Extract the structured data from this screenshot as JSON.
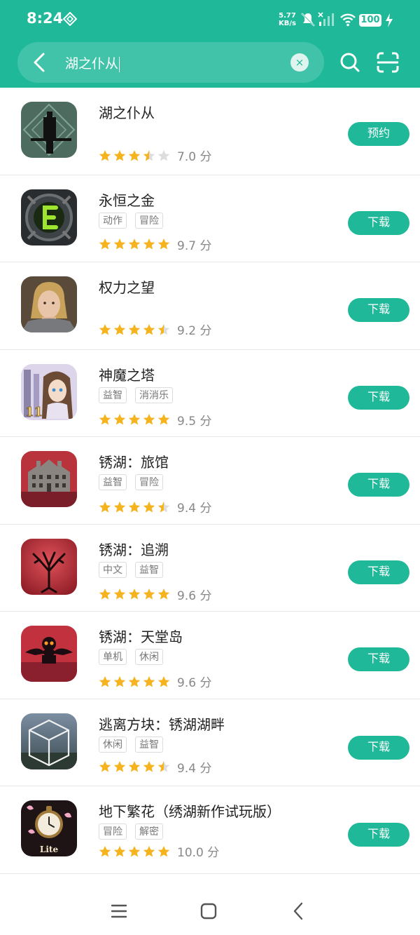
{
  "status_bar": {
    "time": "8:24",
    "speed_value": "5.77",
    "speed_unit": "KB/s",
    "battery": "100"
  },
  "search": {
    "query": "湖之仆从",
    "clear_glyph": "×"
  },
  "results": [
    {
      "name": "湖之仆从",
      "tags": [],
      "rating": 3.5,
      "score": "7.0 分",
      "action": "预约",
      "icon": "servant-lake-icon"
    },
    {
      "name": "永恒之金",
      "tags": [
        "动作",
        "冒险"
      ],
      "rating": 5,
      "score": "9.7 分",
      "action": "下载",
      "icon": "eternal-gold-icon"
    },
    {
      "name": "权力之望",
      "tags": [],
      "rating": 4.5,
      "score": "9.2 分",
      "action": "下载",
      "icon": "power-desire-icon"
    },
    {
      "name": "神魔之塔",
      "tags": [
        "益智",
        "消消乐"
      ],
      "rating": 5,
      "score": "9.5 分",
      "action": "下载",
      "icon": "tower-of-saviors-icon"
    },
    {
      "name": "锈湖：旅馆",
      "tags": [
        "益智",
        "冒险"
      ],
      "rating": 4.5,
      "score": "9.4 分",
      "action": "下载",
      "icon": "rusty-lake-hotel-icon"
    },
    {
      "name": "锈湖：追溯",
      "tags": [
        "中文",
        "益智"
      ],
      "rating": 5,
      "score": "9.6 分",
      "action": "下载",
      "icon": "rusty-lake-roots-icon"
    },
    {
      "name": "锈湖：天堂岛",
      "tags": [
        "单机",
        "休闲"
      ],
      "rating": 5,
      "score": "9.6 分",
      "action": "下载",
      "icon": "rusty-lake-paradise-icon"
    },
    {
      "name": "逃离方块：锈湖湖畔",
      "tags": [
        "休闲",
        "益智"
      ],
      "rating": 4.5,
      "score": "9.4 分",
      "action": "下载",
      "icon": "cube-escape-lake-icon"
    },
    {
      "name": "地下繁花（绣湖新作试玩版）",
      "tags": [
        "冒险",
        "解密"
      ],
      "rating": 5,
      "score": "10.0 分",
      "action": "下载",
      "icon": "underground-blossom-lite-icon",
      "badge": "Lite"
    }
  ],
  "colors": {
    "accent": "#1fb99a",
    "star": "#f5b41f",
    "star_empty": "#dddddd"
  }
}
